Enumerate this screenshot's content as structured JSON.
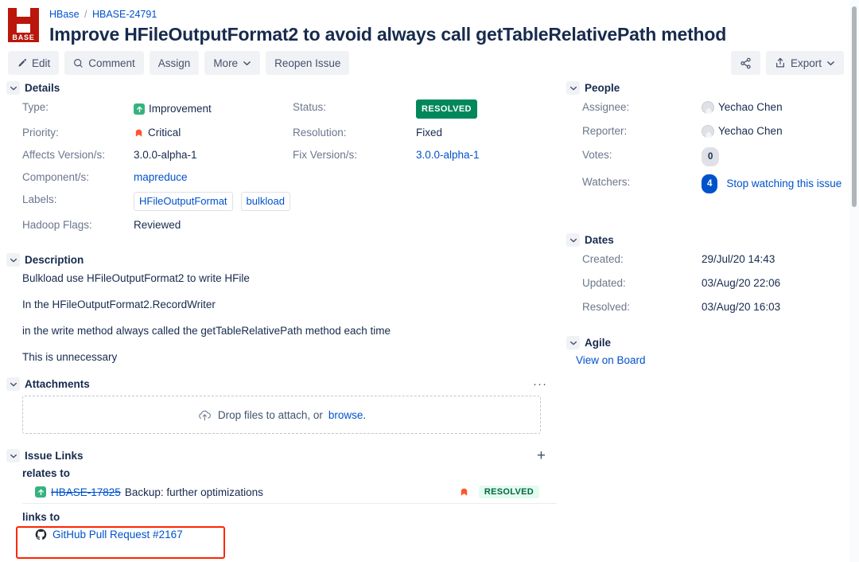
{
  "header": {
    "logo_text": "BASE",
    "breadcrumb": {
      "project": "HBase",
      "separator": "/",
      "issue_key": "HBASE-24791"
    },
    "title": "Improve HFileOutputFormat2 to avoid always call getTableRelativePath method"
  },
  "toolbar": {
    "edit": "Edit",
    "comment": "Comment",
    "assign": "Assign",
    "more": "More",
    "reopen": "Reopen Issue",
    "export": "Export"
  },
  "details": {
    "section_title": "Details",
    "type_label": "Type:",
    "type_value": "Improvement",
    "status_label": "Status:",
    "status_value": "RESOLVED",
    "priority_label": "Priority:",
    "priority_value": "Critical",
    "resolution_label": "Resolution:",
    "resolution_value": "Fixed",
    "affects_label": "Affects Version/s:",
    "affects_value": "3.0.0-alpha-1",
    "fix_label": "Fix Version/s:",
    "fix_value": "3.0.0-alpha-1",
    "component_label": "Component/s:",
    "component_value": "mapreduce",
    "labels_label": "Labels:",
    "labels": [
      "HFileOutputFormat",
      "bulkload"
    ],
    "hadoop_flags_label": "Hadoop Flags:",
    "hadoop_flags_value": "Reviewed"
  },
  "description": {
    "section_title": "Description",
    "paragraphs": [
      "Bulkload use HFileOutputFormat2 to write HFile",
      "In the HFileOutputFormat2.RecordWriter",
      "in the write method always called the getTableRelativePath method each time",
      "This is unnecessary"
    ]
  },
  "attachments": {
    "section_title": "Attachments",
    "more_actions": "···",
    "drop_text": "Drop files to attach, or",
    "browse_text": "browse."
  },
  "issue_links": {
    "section_title": "Issue Links",
    "add_icon": "+",
    "groups": [
      {
        "title": "relates to",
        "rows": [
          {
            "key": "HBASE-17825",
            "summary": "Backup: further optimizations",
            "status": "RESOLVED"
          }
        ]
      },
      {
        "title": "links to",
        "github_link": "GitHub Pull Request #2167"
      }
    ]
  },
  "people": {
    "section_title": "People",
    "assignee_label": "Assignee:",
    "assignee_value": "Yechao Chen",
    "reporter_label": "Reporter:",
    "reporter_value": "Yechao Chen",
    "votes_label": "Votes:",
    "votes_value": "0",
    "watchers_label": "Watchers:",
    "watchers_count": "4",
    "watchers_action": "Stop watching this issue"
  },
  "dates": {
    "section_title": "Dates",
    "created_label": "Created:",
    "created_value": "29/Jul/20 14:43",
    "updated_label": "Updated:",
    "updated_value": "03/Aug/20 22:06",
    "resolved_label": "Resolved:",
    "resolved_value": "03/Aug/20 16:03"
  },
  "agile": {
    "section_title": "Agile",
    "view_board": "View on Board"
  },
  "colors": {
    "link": "#0052cc",
    "status_green": "#00875a",
    "improvement_green": "#36b37e",
    "critical_orange": "#ff5630",
    "highlight_red": "#ff2600",
    "logo_red": "#ba160c"
  }
}
